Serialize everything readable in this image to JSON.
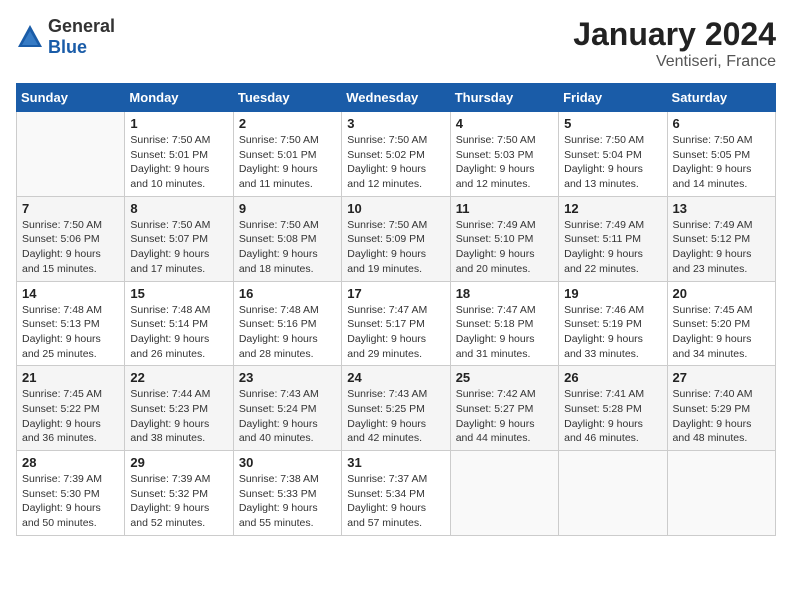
{
  "header": {
    "logo_general": "General",
    "logo_blue": "Blue",
    "title": "January 2024",
    "location": "Ventiseri, France"
  },
  "days_of_week": [
    "Sunday",
    "Monday",
    "Tuesday",
    "Wednesday",
    "Thursday",
    "Friday",
    "Saturday"
  ],
  "weeks": [
    [
      {
        "day": "",
        "empty": true
      },
      {
        "day": "1",
        "sunrise": "7:50 AM",
        "sunset": "5:01 PM",
        "daylight": "9 hours and 10 minutes."
      },
      {
        "day": "2",
        "sunrise": "7:50 AM",
        "sunset": "5:01 PM",
        "daylight": "9 hours and 11 minutes."
      },
      {
        "day": "3",
        "sunrise": "7:50 AM",
        "sunset": "5:02 PM",
        "daylight": "9 hours and 12 minutes."
      },
      {
        "day": "4",
        "sunrise": "7:50 AM",
        "sunset": "5:03 PM",
        "daylight": "9 hours and 12 minutes."
      },
      {
        "day": "5",
        "sunrise": "7:50 AM",
        "sunset": "5:04 PM",
        "daylight": "9 hours and 13 minutes."
      },
      {
        "day": "6",
        "sunrise": "7:50 AM",
        "sunset": "5:05 PM",
        "daylight": "9 hours and 14 minutes."
      }
    ],
    [
      {
        "day": "7",
        "sunrise": "7:50 AM",
        "sunset": "5:06 PM",
        "daylight": "9 hours and 15 minutes."
      },
      {
        "day": "8",
        "sunrise": "7:50 AM",
        "sunset": "5:07 PM",
        "daylight": "9 hours and 17 minutes."
      },
      {
        "day": "9",
        "sunrise": "7:50 AM",
        "sunset": "5:08 PM",
        "daylight": "9 hours and 18 minutes."
      },
      {
        "day": "10",
        "sunrise": "7:50 AM",
        "sunset": "5:09 PM",
        "daylight": "9 hours and 19 minutes."
      },
      {
        "day": "11",
        "sunrise": "7:49 AM",
        "sunset": "5:10 PM",
        "daylight": "9 hours and 20 minutes."
      },
      {
        "day": "12",
        "sunrise": "7:49 AM",
        "sunset": "5:11 PM",
        "daylight": "9 hours and 22 minutes."
      },
      {
        "day": "13",
        "sunrise": "7:49 AM",
        "sunset": "5:12 PM",
        "daylight": "9 hours and 23 minutes."
      }
    ],
    [
      {
        "day": "14",
        "sunrise": "7:48 AM",
        "sunset": "5:13 PM",
        "daylight": "9 hours and 25 minutes."
      },
      {
        "day": "15",
        "sunrise": "7:48 AM",
        "sunset": "5:14 PM",
        "daylight": "9 hours and 26 minutes."
      },
      {
        "day": "16",
        "sunrise": "7:48 AM",
        "sunset": "5:16 PM",
        "daylight": "9 hours and 28 minutes."
      },
      {
        "day": "17",
        "sunrise": "7:47 AM",
        "sunset": "5:17 PM",
        "daylight": "9 hours and 29 minutes."
      },
      {
        "day": "18",
        "sunrise": "7:47 AM",
        "sunset": "5:18 PM",
        "daylight": "9 hours and 31 minutes."
      },
      {
        "day": "19",
        "sunrise": "7:46 AM",
        "sunset": "5:19 PM",
        "daylight": "9 hours and 33 minutes."
      },
      {
        "day": "20",
        "sunrise": "7:45 AM",
        "sunset": "5:20 PM",
        "daylight": "9 hours and 34 minutes."
      }
    ],
    [
      {
        "day": "21",
        "sunrise": "7:45 AM",
        "sunset": "5:22 PM",
        "daylight": "9 hours and 36 minutes."
      },
      {
        "day": "22",
        "sunrise": "7:44 AM",
        "sunset": "5:23 PM",
        "daylight": "9 hours and 38 minutes."
      },
      {
        "day": "23",
        "sunrise": "7:43 AM",
        "sunset": "5:24 PM",
        "daylight": "9 hours and 40 minutes."
      },
      {
        "day": "24",
        "sunrise": "7:43 AM",
        "sunset": "5:25 PM",
        "daylight": "9 hours and 42 minutes."
      },
      {
        "day": "25",
        "sunrise": "7:42 AM",
        "sunset": "5:27 PM",
        "daylight": "9 hours and 44 minutes."
      },
      {
        "day": "26",
        "sunrise": "7:41 AM",
        "sunset": "5:28 PM",
        "daylight": "9 hours and 46 minutes."
      },
      {
        "day": "27",
        "sunrise": "7:40 AM",
        "sunset": "5:29 PM",
        "daylight": "9 hours and 48 minutes."
      }
    ],
    [
      {
        "day": "28",
        "sunrise": "7:39 AM",
        "sunset": "5:30 PM",
        "daylight": "9 hours and 50 minutes."
      },
      {
        "day": "29",
        "sunrise": "7:39 AM",
        "sunset": "5:32 PM",
        "daylight": "9 hours and 52 minutes."
      },
      {
        "day": "30",
        "sunrise": "7:38 AM",
        "sunset": "5:33 PM",
        "daylight": "9 hours and 55 minutes."
      },
      {
        "day": "31",
        "sunrise": "7:37 AM",
        "sunset": "5:34 PM",
        "daylight": "9 hours and 57 minutes."
      },
      {
        "day": "",
        "empty": true
      },
      {
        "day": "",
        "empty": true
      },
      {
        "day": "",
        "empty": true
      }
    ]
  ],
  "labels": {
    "sunrise_prefix": "Sunrise: ",
    "sunset_prefix": "Sunset: ",
    "daylight_prefix": "Daylight: "
  }
}
